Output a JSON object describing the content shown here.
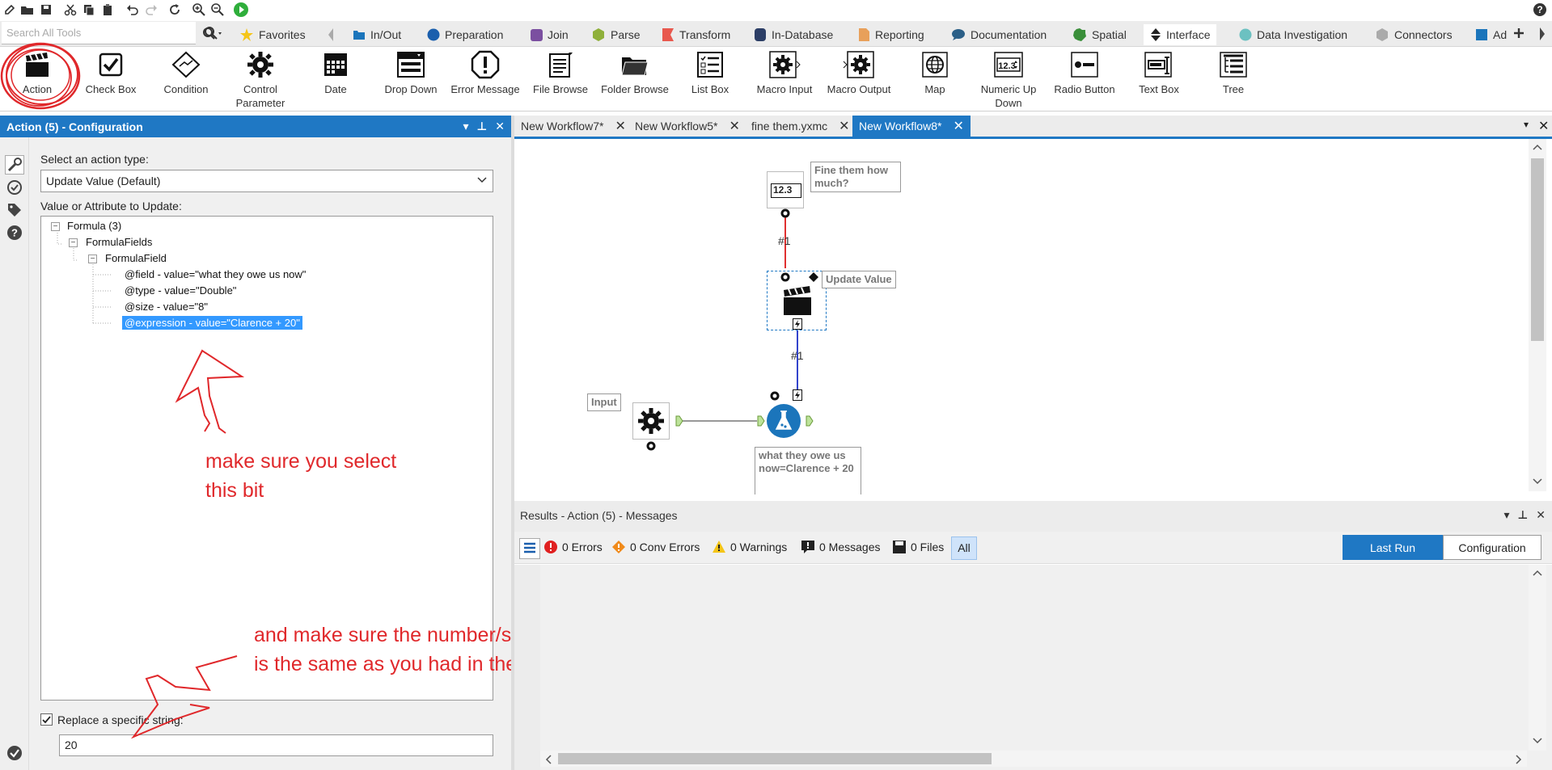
{
  "quick_toolbar": {
    "icons": [
      "new-icon",
      "open-icon",
      "save-icon",
      "cut-icon",
      "copy-icon",
      "paste-icon",
      "undo-icon",
      "redo-icon",
      "refresh-icon",
      "zoom-in-icon",
      "zoom-out-icon",
      "run-icon",
      "help-icon"
    ]
  },
  "search": {
    "placeholder": "Search All Tools"
  },
  "categories": [
    {
      "label": "Favorites",
      "color": "#f5c518"
    },
    {
      "label": "In/Out",
      "color": "#1b75bb"
    },
    {
      "label": "Preparation",
      "color": "#1b75bb"
    },
    {
      "label": "Join",
      "color": "#7b4fa0"
    },
    {
      "label": "Parse",
      "color": "#8fb03a"
    },
    {
      "label": "Transform",
      "color": "#e8584e"
    },
    {
      "label": "In-Database",
      "color": "#2c3e66"
    },
    {
      "label": "Reporting",
      "color": "#e8a05a"
    },
    {
      "label": "Documentation",
      "color": "#2b5f87"
    },
    {
      "label": "Spatial",
      "color": "#3a8f3a"
    },
    {
      "label": "Interface",
      "color": "#222222"
    },
    {
      "label": "Data Investigation",
      "color": "#6cc1c1"
    },
    {
      "label": "Connectors",
      "color": "#999999"
    },
    {
      "label": "Ad",
      "color": "#1b75bb"
    }
  ],
  "tools": [
    {
      "label": "Action"
    },
    {
      "label": "Check Box"
    },
    {
      "label": "Condition"
    },
    {
      "label": "Control Parameter"
    },
    {
      "label": "Date"
    },
    {
      "label": "Drop Down"
    },
    {
      "label": "Error Message"
    },
    {
      "label": "File Browse"
    },
    {
      "label": "Folder Browse"
    },
    {
      "label": "List Box"
    },
    {
      "label": "Macro Input"
    },
    {
      "label": "Macro Output"
    },
    {
      "label": "Map"
    },
    {
      "label": "Numeric Up Down"
    },
    {
      "label": "Radio Button"
    },
    {
      "label": "Text Box"
    },
    {
      "label": "Tree"
    }
  ],
  "config": {
    "title": "Action (5) - Configuration",
    "action_type_label": "Select an action type:",
    "action_type_value": "Update Value (Default)",
    "value_label": "Value or Attribute to Update:",
    "tree": [
      {
        "label": "Formula (3)"
      },
      {
        "label": "FormulaFields"
      },
      {
        "label": "FormulaField"
      },
      {
        "label": "@field - value=\"what they owe us now\""
      },
      {
        "label": "@type - value=\"Double\""
      },
      {
        "label": "@size - value=\"8\""
      },
      {
        "label": "@expression - value=\"Clarence + 20\""
      }
    ],
    "replace_label": "Replace a specific string:",
    "replace_checked": true,
    "replace_value": "20"
  },
  "workflow_tabs": [
    {
      "label": "New Workflow7*"
    },
    {
      "label": "New Workflow5*"
    },
    {
      "label": "fine them.yxmc"
    },
    {
      "label": "New Workflow8*"
    }
  ],
  "canvas": {
    "numeric_value": "12.3",
    "annotation_fine": "Fine them how much?",
    "connection_label_1": "#1",
    "annotation_update": "Update Value",
    "connection_label_2": "#1",
    "annotation_input": "Input",
    "annotation_formula": "what they owe us now=Clarence + 20"
  },
  "results": {
    "title": "Results - Action (5) - Messages",
    "errors": "0 Errors",
    "conv_errors": "0 Conv Errors",
    "warnings": "0 Warnings",
    "messages": "0 Messages",
    "files": "0 Files",
    "all": "All",
    "last_run": "Last Run",
    "configuration": "Configuration"
  },
  "handwritten_notes": {
    "note1_line1": "make sure you select",
    "note1_line2": "this bit",
    "note2_line1": "and make sure the number/string here",
    "note2_line2": "is the same as you had in the formula"
  },
  "colors": {
    "accent": "#1f78c4",
    "annotation_red": "#e0282b",
    "selection": "#3399ff"
  }
}
